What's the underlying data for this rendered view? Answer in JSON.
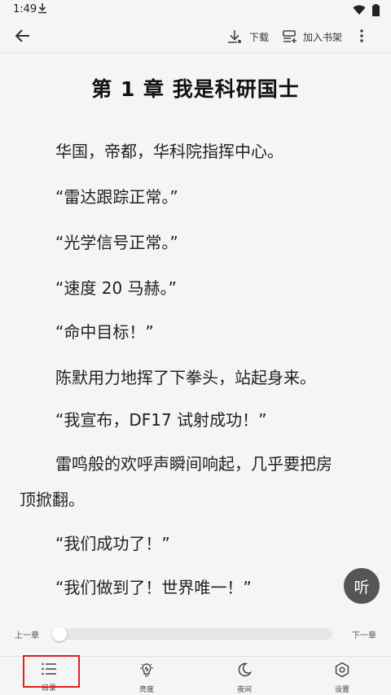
{
  "status_bar": {
    "time": "1:49"
  },
  "toolbar": {
    "download_label": "下载",
    "add_shelf_label": "加入书架"
  },
  "reader": {
    "chapter_title": "第 1 章 我是科研国士",
    "paragraphs": [
      "华国，帝都，华科院指挥中心。",
      "“雷达跟踪正常。”",
      "“光学信号正常。”",
      "“速度 20 马赫。”",
      "“命中目标！”",
      "陈默用力地挥了下拳头，站起身来。",
      "“我宣布，DF17 试射成功！”",
      "雷鸣般的欢呼声瞬间响起，几乎要把房",
      "顶掀翻。",
      "“我们成功了！”",
      "“我们做到了！世界唯一！”"
    ]
  },
  "listen_label": "听",
  "progress": {
    "prev_label": "上一章",
    "next_label": "下一章",
    "value": 0
  },
  "bottom_nav": {
    "items": [
      {
        "label": "目录",
        "icon": "list-icon"
      },
      {
        "label": "亮度",
        "icon": "brightness-icon"
      },
      {
        "label": "夜间",
        "icon": "moon-icon"
      },
      {
        "label": "设置",
        "icon": "settings-icon"
      }
    ]
  },
  "colors": {
    "background": "#f5f5f5",
    "highlight": "#e02020",
    "fab": "#555555"
  }
}
